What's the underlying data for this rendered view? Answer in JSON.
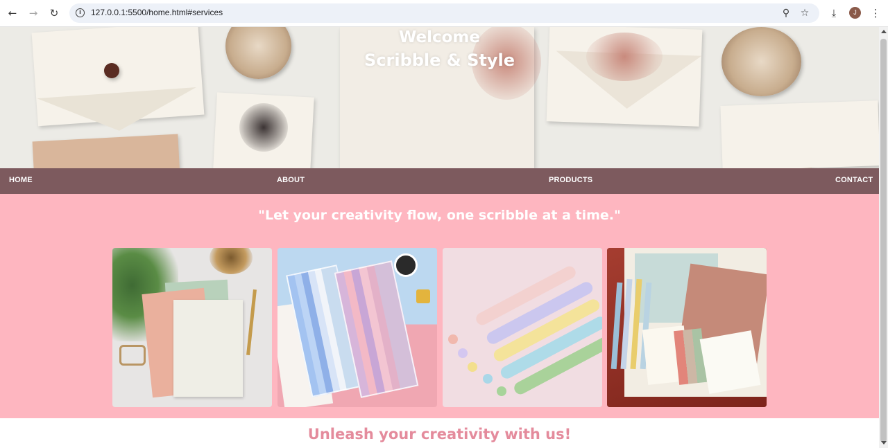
{
  "browser": {
    "url": "127.0.0.1:5500/home.html#services",
    "avatar_initial": "J",
    "icons": [
      "back-arrow-icon",
      "forward-arrow-icon",
      "reload-icon",
      "site-info-icon",
      "zoom-icon",
      "bookmark-star-icon",
      "download-icon",
      "menu-dots-icon"
    ]
  },
  "hero": {
    "title_line1": "Welcome",
    "title_line2": "Scribble & Style"
  },
  "nav": {
    "items": [
      {
        "label": "HOME"
      },
      {
        "label": "ABOUT"
      },
      {
        "label": "PRODUCTS"
      },
      {
        "label": "CONTACT"
      }
    ]
  },
  "services": {
    "quote": "\"Let your creativity flow, one scribble at a time.\"",
    "cards": [
      {
        "name": "notebook-card"
      },
      {
        "name": "pen-set-card"
      },
      {
        "name": "gel-pens-card"
      },
      {
        "name": "stationery-box-card"
      }
    ]
  },
  "footer": {
    "tagline": "Unleash your creativity with us!"
  },
  "colors": {
    "nav_bg": "#7d5a5e",
    "section_bg": "#feb6c0",
    "tagline": "#e48b9c"
  }
}
